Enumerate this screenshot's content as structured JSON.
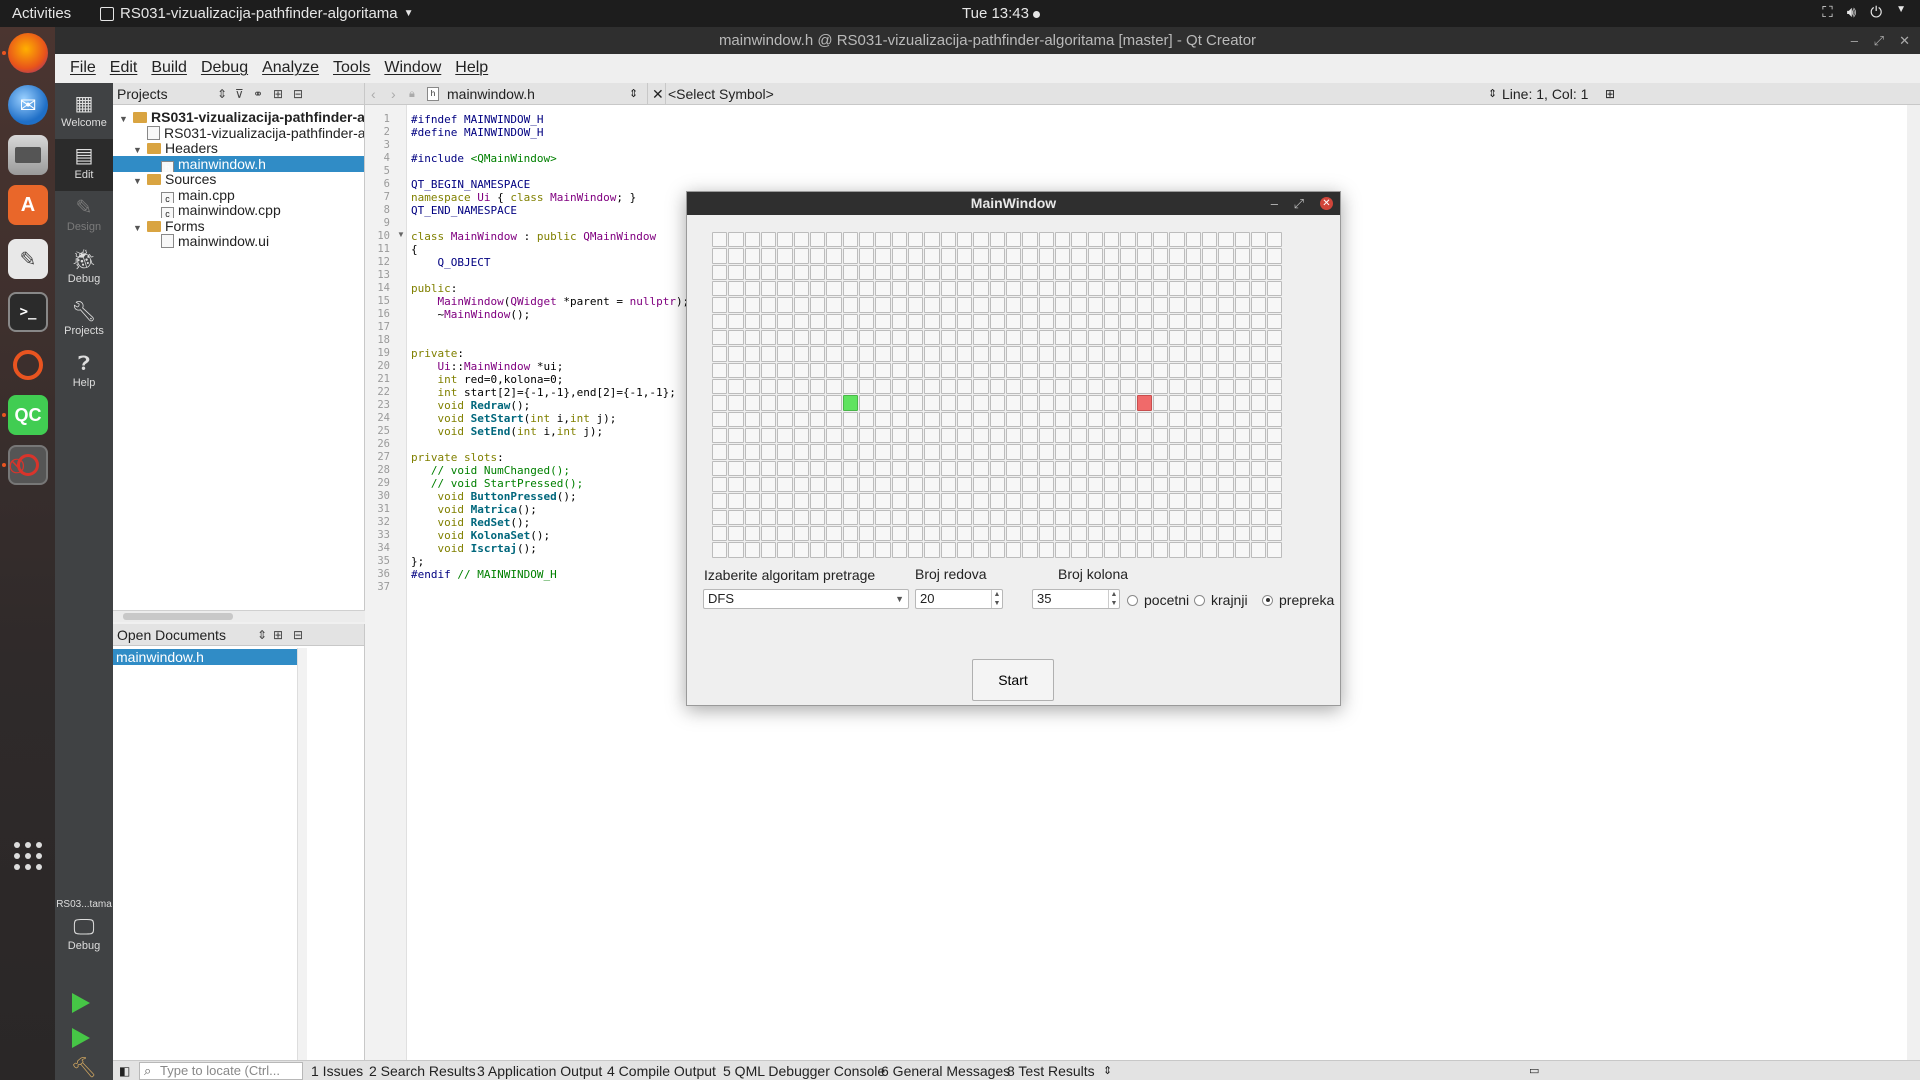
{
  "topbar": {
    "activities": "Activities",
    "app_name": "RS031-vizualizacija-pathfinder-algoritama",
    "clock": "Tue 13:43"
  },
  "qtcreator": {
    "title": "mainwindow.h @ RS031-vizualizacija-pathfinder-algoritama [master] - Qt Creator",
    "menu": [
      "File",
      "Edit",
      "Build",
      "Debug",
      "Analyze",
      "Tools",
      "Window",
      "Help"
    ],
    "modes": [
      {
        "label": "Welcome",
        "icon": "grid-icon"
      },
      {
        "label": "Edit",
        "icon": "edit-doc-icon"
      },
      {
        "label": "Design",
        "icon": "pencil-icon"
      },
      {
        "label": "Debug",
        "icon": "bug-icon"
      },
      {
        "label": "Projects",
        "icon": "wrench-icon"
      },
      {
        "label": "Help",
        "icon": "help-icon"
      }
    ],
    "kit": {
      "project_short": "RS03...tama",
      "label": "Debug"
    },
    "projects_pane": {
      "title": "Projects",
      "tree": [
        {
          "label": "RS031-vizualizacija-pathfinder-algoritama",
          "level": 0,
          "kind": "project",
          "expanded": true
        },
        {
          "label": "RS031-vizualizacija-pathfinder-algoritama.pro",
          "level": 1,
          "kind": "file"
        },
        {
          "label": "Headers",
          "level": 1,
          "kind": "folder",
          "expanded": true
        },
        {
          "label": "mainwindow.h",
          "level": 2,
          "kind": "header",
          "selected": true
        },
        {
          "label": "Sources",
          "level": 1,
          "kind": "folder",
          "expanded": true
        },
        {
          "label": "main.cpp",
          "level": 2,
          "kind": "source"
        },
        {
          "label": "mainwindow.cpp",
          "level": 2,
          "kind": "source"
        },
        {
          "label": "Forms",
          "level": 1,
          "kind": "folder",
          "expanded": true
        },
        {
          "label": "mainwindow.ui",
          "level": 2,
          "kind": "form"
        }
      ]
    },
    "open_documents": {
      "title": "Open Documents",
      "items": [
        "mainwindow.h"
      ]
    },
    "editor": {
      "file": "mainwindow.h",
      "symbol": "<Select Symbol>",
      "position": "Line: 1, Col: 1",
      "lines": [
        "#ifndef MAINWINDOW_H",
        "#define MAINWINDOW_H",
        "",
        "#include <QMainWindow>",
        "",
        "QT_BEGIN_NAMESPACE",
        "namespace Ui { class MainWindow; }",
        "QT_END_NAMESPACE",
        "",
        "class MainWindow : public QMainWindow",
        "{",
        "    Q_OBJECT",
        "",
        "public:",
        "    MainWindow(QWidget *parent = nullptr);",
        "    ~MainWindow();",
        "",
        "",
        "private:",
        "    Ui::MainWindow *ui;",
        "    int red=0,kolona=0;",
        "    int start[2]={-1,-1},end[2]={-1,-1};",
        "    void Redraw();",
        "    void SetStart(int i,int j);",
        "    void SetEnd(int i,int j);",
        "",
        "private slots:",
        "   // void NumChanged();",
        "   // void StartPressed();",
        "    void ButtonPressed();",
        "    void Matrica();",
        "    void RedSet();",
        "    void KolonaSet();",
        "    void Iscrtaj();",
        "};",
        "#endif // MAINWINDOW_H",
        ""
      ]
    },
    "statusbar": {
      "locate_placeholder": "Type to locate (Ctrl...",
      "tabs": [
        "1  Issues",
        "2  Search Results",
        "3  Application Output",
        "4  Compile Output",
        "5  QML Debugger Console",
        "6  General Messages",
        "8  Test Results"
      ]
    }
  },
  "mainwindow": {
    "title": "MainWindow",
    "grid": {
      "rows": 20,
      "cols": 35,
      "start": [
        10,
        8
      ],
      "end": [
        10,
        26
      ]
    },
    "algo_label": "Izaberite algoritam pretrage",
    "algo_value": "DFS",
    "rows_label": "Broj redova",
    "rows_value": "20",
    "cols_label": "Broj kolona",
    "cols_value": "35",
    "radios": [
      {
        "label": "pocetni",
        "checked": false
      },
      {
        "label": "krajnji",
        "checked": false
      },
      {
        "label": "prepreka",
        "checked": true
      }
    ],
    "start_button": "Start"
  },
  "colors": {
    "start_cell": "#5fe35f",
    "end_cell": "#f06a6a",
    "selection": "#308cc6"
  }
}
